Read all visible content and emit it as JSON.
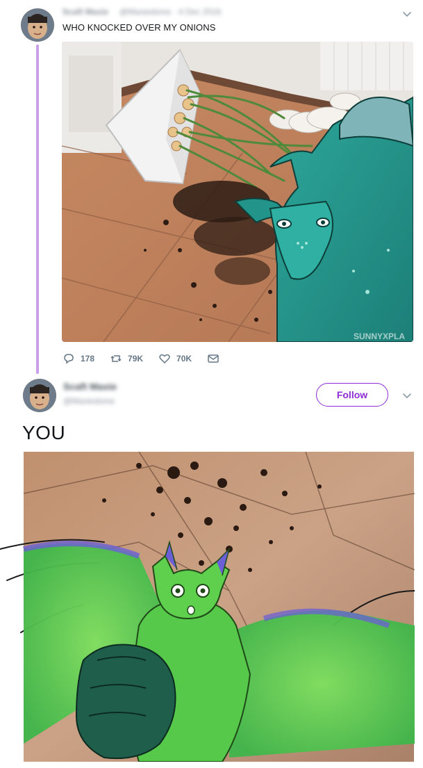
{
  "tweet1": {
    "author_name": "Scaft Maxie",
    "author_handle": "@Maxiedome · 4 Dec 2016",
    "text": "WHO KNOCKED OVER MY ONIONS",
    "image_watermark": "SUNNYXPLA",
    "actions": {
      "replies": "178",
      "retweets": "79K",
      "likes": "70K"
    },
    "icons": [
      "reply-icon",
      "retweet-icon",
      "like-icon",
      "message-icon",
      "chevron-down-icon"
    ]
  },
  "tweet2": {
    "author_name": "Scaft Maxie",
    "author_handle": "@Maxiedome",
    "follow_label": "Follow",
    "text": "YOU",
    "icons": [
      "chevron-down-icon"
    ]
  },
  "colors": {
    "accent": "#8d2bd6",
    "thread_line": "#c9a0e8",
    "muted": "#657786"
  }
}
